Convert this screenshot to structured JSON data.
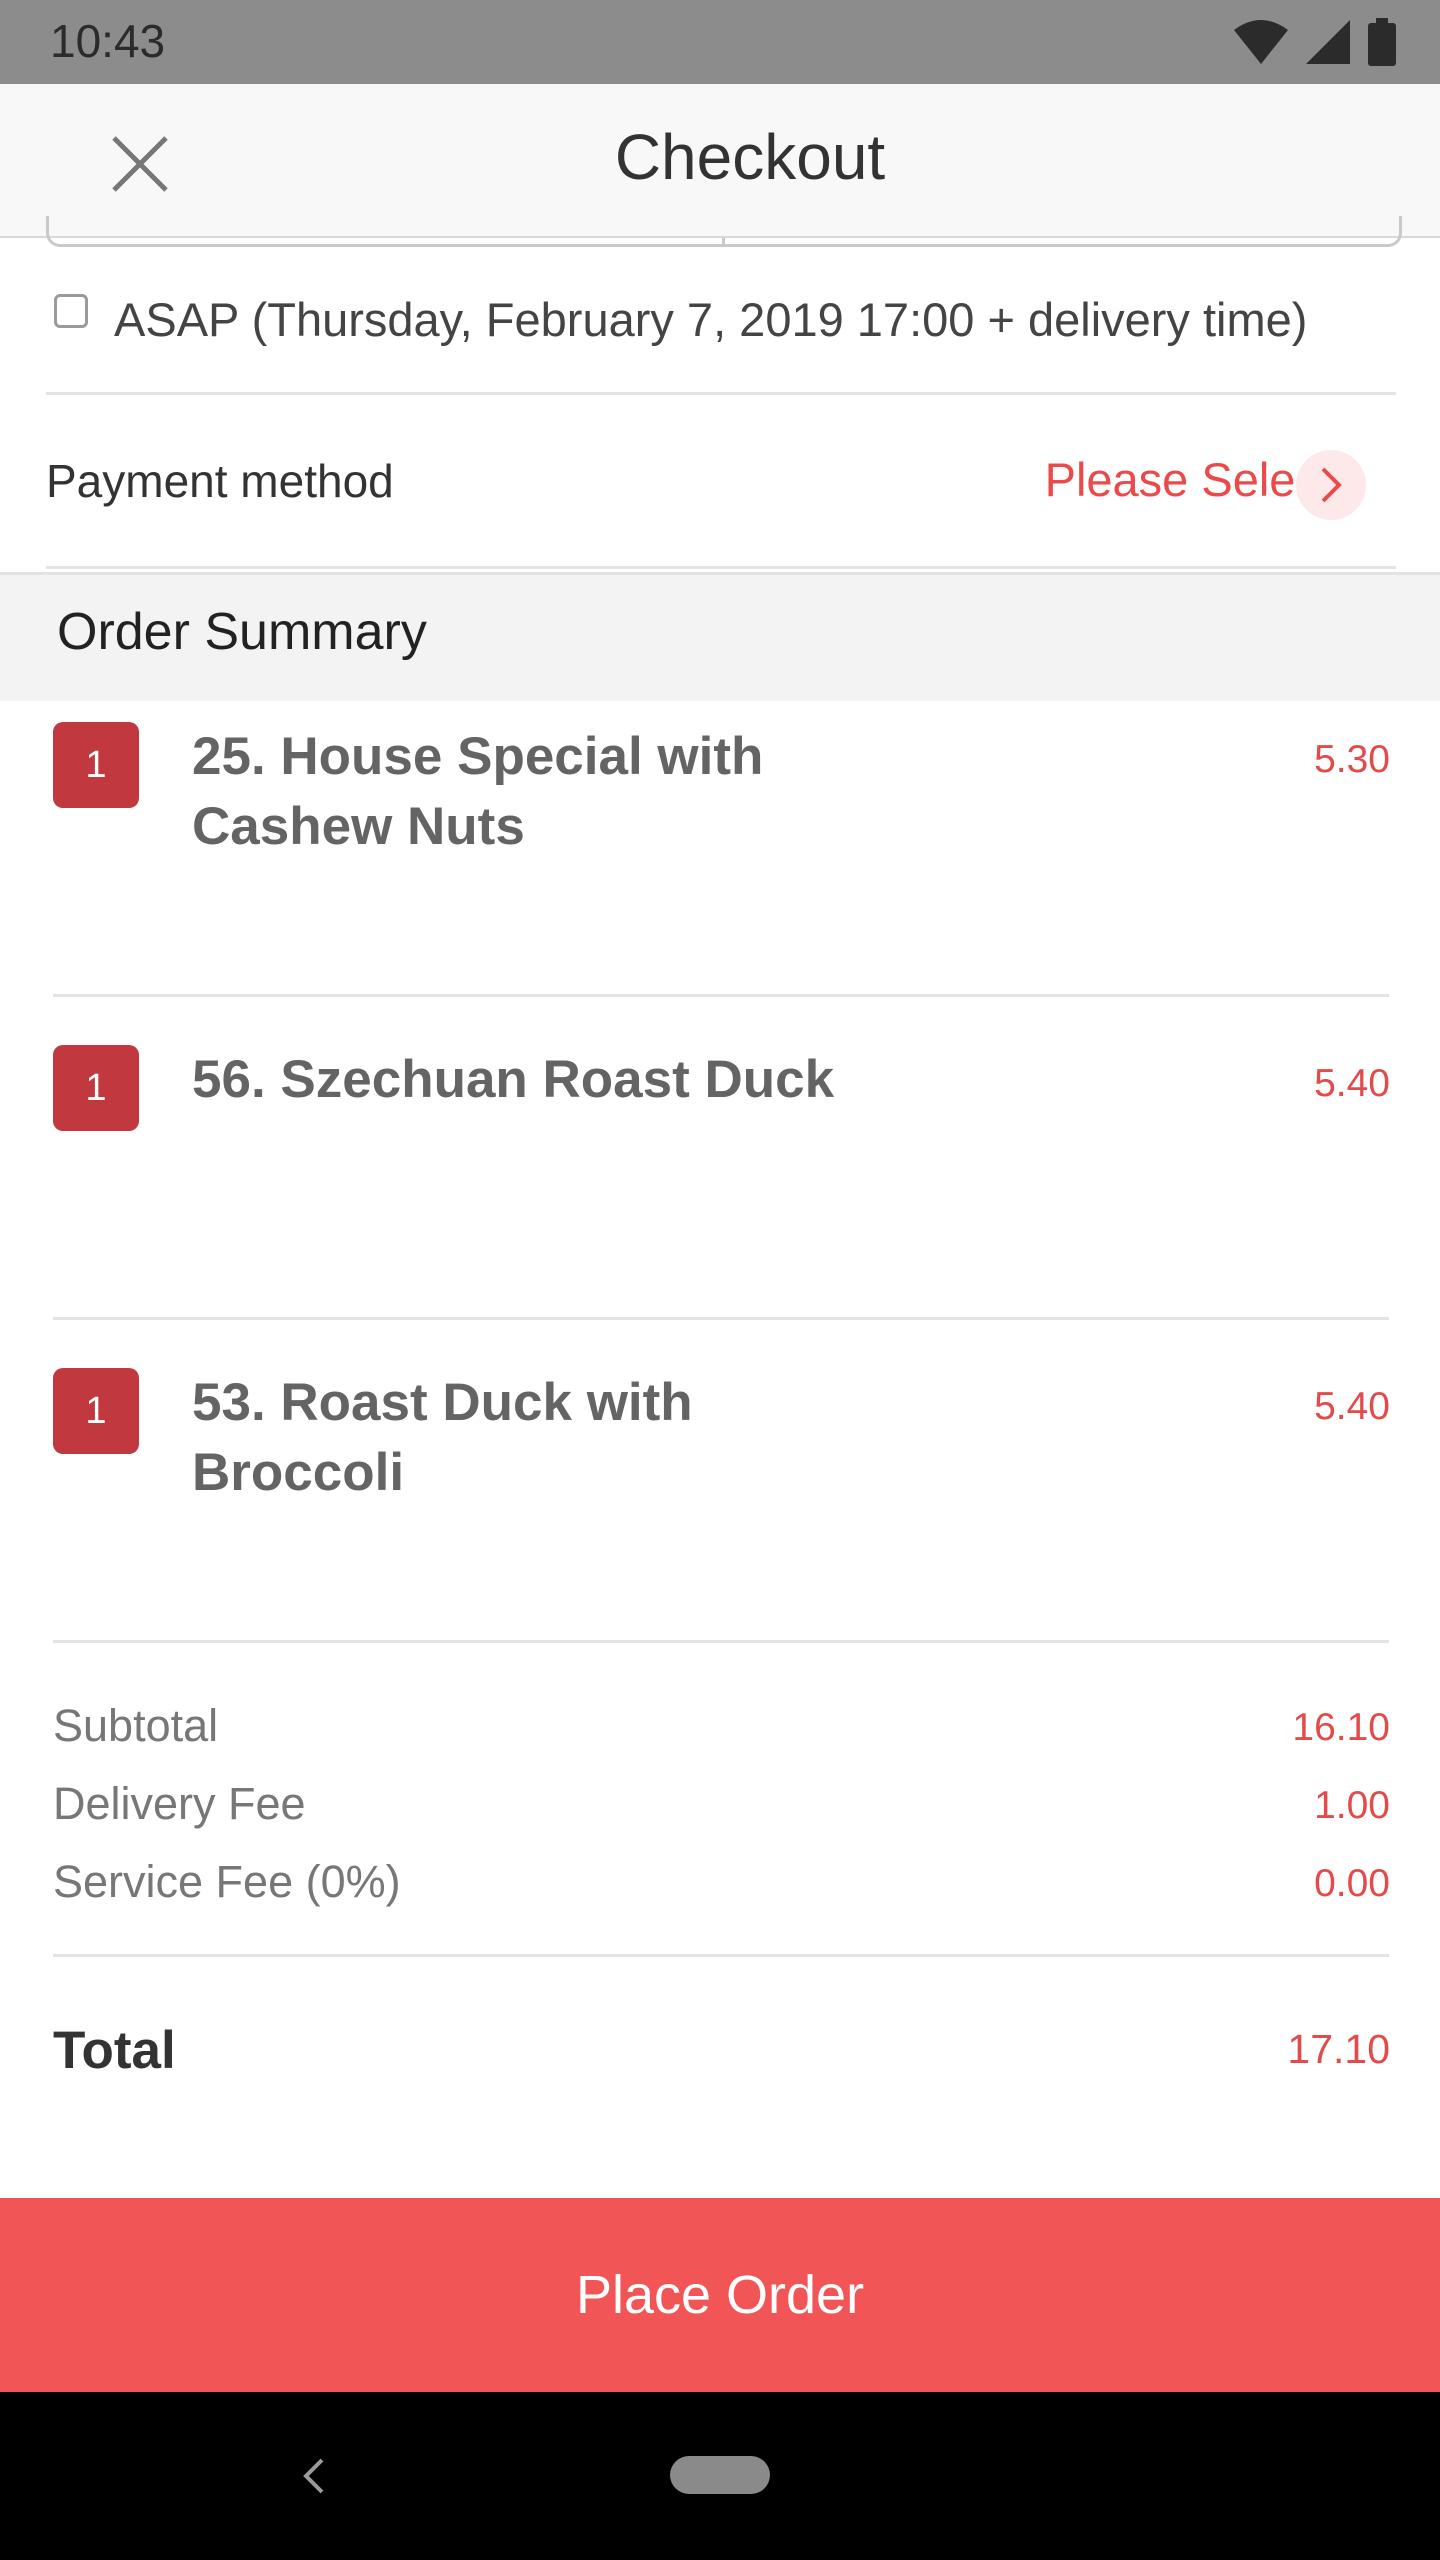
{
  "status_bar": {
    "time": "10:43"
  },
  "app_bar": {
    "title": "Checkout"
  },
  "asap": {
    "label": "ASAP (Thursday, February 7, 2019 17:00 + delivery time)",
    "checked": false
  },
  "payment": {
    "label": "Payment method",
    "value": "Please Select"
  },
  "order_summary": {
    "title": "Order Summary",
    "items": [
      {
        "qty": "1",
        "name": "25. House Special with Cashew Nuts",
        "price": "5.30"
      },
      {
        "qty": "1",
        "name": "56. Szechuan Roast Duck",
        "price": "5.40"
      },
      {
        "qty": "1",
        "name": "53. Roast Duck with Broccoli",
        "price": "5.40"
      }
    ]
  },
  "totals": {
    "subtotal_label": "Subtotal",
    "subtotal": "16.10",
    "delivery_label": "Delivery Fee",
    "delivery": "1.00",
    "service_label": "Service Fee (0%)",
    "service": "0.00",
    "total_label": "Total",
    "total": "17.10"
  },
  "actions": {
    "place_order": "Place Order"
  },
  "colors": {
    "accent": "#f25556",
    "qty_badge": "#c1393e",
    "price": "#e34b4b"
  }
}
